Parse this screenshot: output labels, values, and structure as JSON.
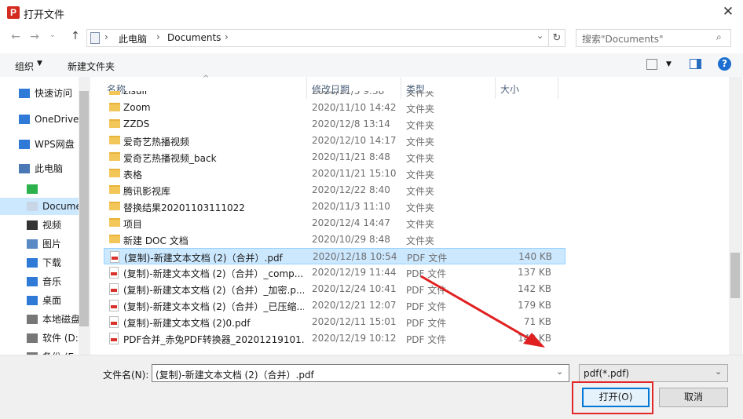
{
  "title": "打开文件",
  "address": {
    "segments": [
      "此电脑",
      "Documents"
    ]
  },
  "search": {
    "placeholder": "搜索\"Documents\""
  },
  "toolbar": {
    "organize": "组织",
    "new_folder": "新建文件夹"
  },
  "nav": [
    {
      "label": "快速访问",
      "icon": "star-icon"
    },
    {
      "label": "OneDrive",
      "icon": "cloud-icon"
    },
    {
      "label": "WPS网盘",
      "icon": "cloud-icon"
    },
    {
      "label": "此电脑",
      "icon": "computer-icon"
    },
    {
      "label": "",
      "icon": "green-app-icon"
    },
    {
      "label": "Docume",
      "icon": "document-icon"
    },
    {
      "label": "视频",
      "icon": "video-icon"
    },
    {
      "label": "图片",
      "icon": "picture-icon"
    },
    {
      "label": "下载",
      "icon": "download-icon"
    },
    {
      "label": "音乐",
      "icon": "music-icon"
    },
    {
      "label": "桌面",
      "icon": "desktop-icon"
    },
    {
      "label": "本地磁盘",
      "icon": "drive-icon"
    },
    {
      "label": "软件 (D:",
      "icon": "drive-icon"
    },
    {
      "label": "备份 (E",
      "icon": "drive-icon"
    }
  ],
  "columns": [
    "名称",
    "修改日期",
    "类型",
    "大小"
  ],
  "files": [
    {
      "name": "zisuil",
      "date": "2020/11/5 9:38",
      "type": "文件夹",
      "size": "",
      "kind": "folder"
    },
    {
      "name": "Zoom",
      "date": "2020/11/10 14:42",
      "type": "文件夹",
      "size": "",
      "kind": "folder"
    },
    {
      "name": "ZZDS",
      "date": "2020/12/8 13:14",
      "type": "文件夹",
      "size": "",
      "kind": "folder"
    },
    {
      "name": "爱奇艺热播视频",
      "date": "2020/12/10 14:17",
      "type": "文件夹",
      "size": "",
      "kind": "folder"
    },
    {
      "name": "爱奇艺热播视频_back",
      "date": "2020/11/21 8:48",
      "type": "文件夹",
      "size": "",
      "kind": "folder"
    },
    {
      "name": "表格",
      "date": "2020/11/21 15:10",
      "type": "文件夹",
      "size": "",
      "kind": "folder"
    },
    {
      "name": "腾讯影视库",
      "date": "2020/12/22 8:40",
      "type": "文件夹",
      "size": "",
      "kind": "folder"
    },
    {
      "name": "替换结果20201103111022",
      "date": "2020/11/3 11:10",
      "type": "文件夹",
      "size": "",
      "kind": "folder"
    },
    {
      "name": "项目",
      "date": "2020/12/4 14:47",
      "type": "文件夹",
      "size": "",
      "kind": "folder"
    },
    {
      "name": "新建 DOC 文档",
      "date": "2020/10/29 8:48",
      "type": "文件夹",
      "size": "",
      "kind": "folder"
    },
    {
      "name": "(复制)-新建文本文档 (2)（合并）.pdf",
      "date": "2020/12/18 10:54",
      "type": "PDF 文件",
      "size": "140 KB",
      "kind": "pdf",
      "selected": true
    },
    {
      "name": "(复制)-新建文本文档 (2)（合并）_comp...",
      "date": "2020/12/19 11:44",
      "type": "PDF 文件",
      "size": "137 KB",
      "kind": "pdf"
    },
    {
      "name": "(复制)-新建文本文档 (2)（合并）_加密.p...",
      "date": "2020/12/24 10:41",
      "type": "PDF 文件",
      "size": "142 KB",
      "kind": "pdf"
    },
    {
      "name": "(复制)-新建文本文档 (2)（合并）_已压缩...",
      "date": "2020/12/21 12:07",
      "type": "PDF 文件",
      "size": "179 KB",
      "kind": "pdf"
    },
    {
      "name": "(复制)-新建文本文档 (2)0.pdf",
      "date": "2020/12/11 15:01",
      "type": "PDF 文件",
      "size": "71 KB",
      "kind": "pdf"
    },
    {
      "name": "PDF合并_赤兔PDF转换器_20201219101...",
      "date": "2020/12/19 10:12",
      "type": "PDF 文件",
      "size": "140 KB",
      "kind": "pdf"
    }
  ],
  "filename": {
    "label": "文件名(N):",
    "value": "(复制)-新建文本文档 (2)（合并）.pdf"
  },
  "filter": {
    "value": "pdf(*.pdf)"
  },
  "buttons": {
    "open": "打开(O)",
    "cancel": "取消"
  },
  "colors": {
    "selection": "#cce8ff",
    "highlight": "#e3262a",
    "arrow": "#e02020",
    "accent": "#0078d7"
  }
}
